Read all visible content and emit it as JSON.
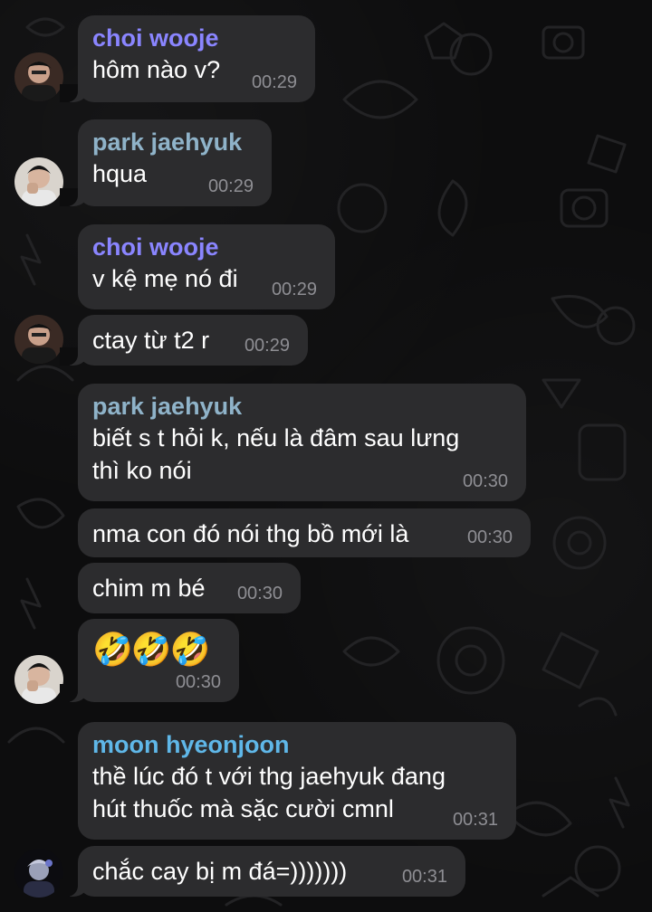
{
  "chat": {
    "messages": [
      {
        "sender": "choi wooje",
        "sender_color": "#8a85ff",
        "text": "hôm nào v?",
        "time": "00:29"
      },
      {
        "sender": "park jaehyuk",
        "sender_color": "#8fb3c9",
        "text": "hqua",
        "time": "00:29"
      },
      {
        "sender": "choi wooje",
        "sender_color": "#8a85ff",
        "text": "v kệ mẹ nó đi",
        "time": "00:29"
      },
      {
        "text": "ctay từ t2 r",
        "time": "00:29"
      },
      {
        "sender": "park jaehyuk",
        "sender_color": "#8fb3c9",
        "text_line1": "biết s t hỏi k, nếu là đâm sau lưng",
        "text_line2": "thì ko nói",
        "time": "00:30"
      },
      {
        "text": "nma con đó nói thg bồ mới là",
        "time": "00:30"
      },
      {
        "text": "chim m bé",
        "time": "00:30"
      },
      {
        "emoji": "🤣🤣🤣",
        "time": "00:30"
      },
      {
        "sender": "moon hyeonjoon",
        "sender_color": "#5fb7e8",
        "text_line1": "thề lúc đó t với thg jaehyuk đang",
        "text_line2": "hút thuốc mà sặc cười cmnl",
        "time": "00:31"
      },
      {
        "text": "chắc cay bị m đá=)))))))",
        "time": "00:31"
      }
    ]
  },
  "icons": {
    "avatar_choi": "avatar-photo",
    "avatar_park": "avatar-photo",
    "avatar_moon": "avatar-photo"
  }
}
